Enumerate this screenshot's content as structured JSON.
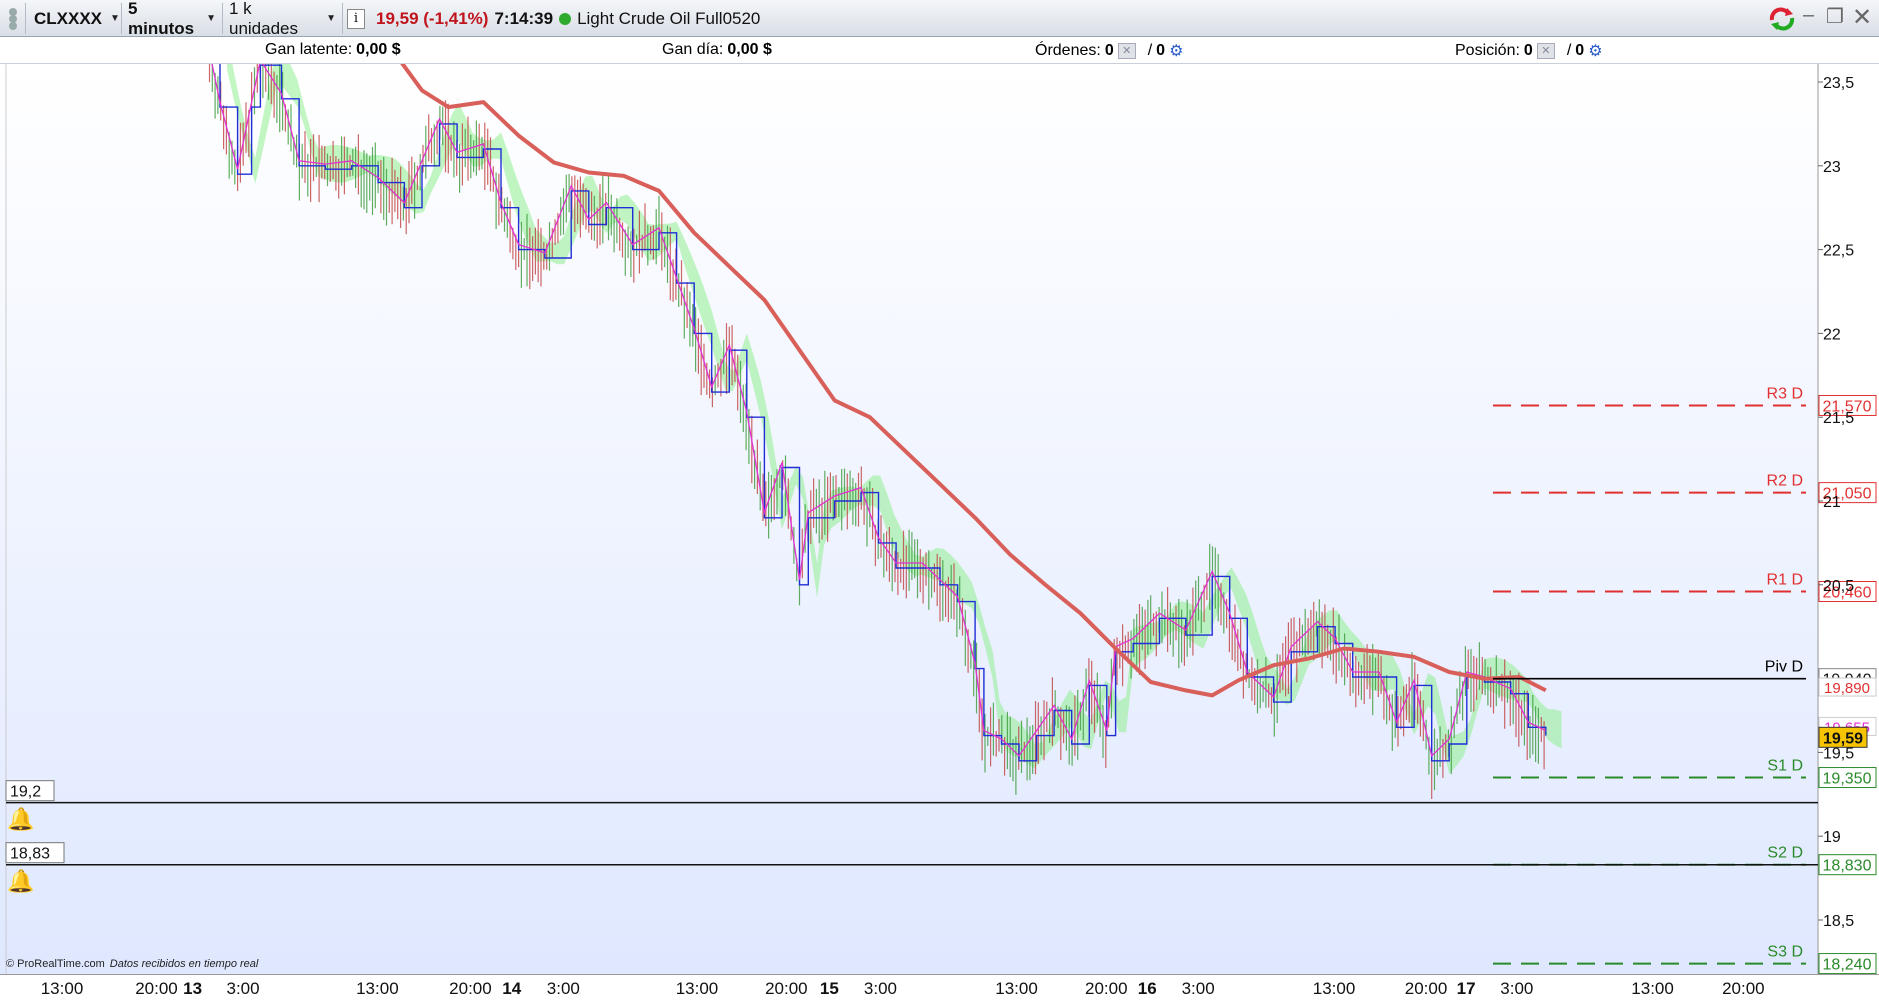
{
  "toolbar": {
    "symbol": "CLXXXX",
    "timeframe": "5 minutos",
    "units": "1 k unidades",
    "info_icon": "info-icon",
    "price_change": "19,59 (-1,41%)",
    "time": "7:14:39",
    "status_color": "#2eaa2e",
    "instrument_name": "Light Crude Oil Full0520"
  },
  "status": {
    "unrealized_label": "Gan latente:",
    "unrealized_value": "0,00 $",
    "day_label": "Gan día:",
    "day_value": "0,00 $",
    "orders_label": "Órdenes:",
    "orders_value": "0",
    "orders_value2": "0",
    "position_label": "Posición:",
    "position_value": "0",
    "position_value2": "0"
  },
  "alerts": [
    {
      "label": "19,2",
      "value": 19.2
    },
    {
      "label": "18,83",
      "value": 18.83
    }
  ],
  "footer": {
    "copyright": "© ProRealTime.com",
    "source_note": "Datos recibidos en tiempo real"
  },
  "colors": {
    "bg_top": "#ffffff",
    "bg_bottom": "#dfe8ff",
    "resistance": "#e03030",
    "support": "#2a8a2a",
    "pivot": "#000000",
    "ma_long": "#d9605a",
    "price_blue": "#1f2fd6",
    "price_magenta": "#e030d0",
    "cloud": "#90ee90",
    "last_price_bg": "#f6c400"
  },
  "chart_data": {
    "type": "line",
    "title": "",
    "ylim": [
      18.0,
      23.65
    ],
    "y_ticks": [
      {
        "v": 23.5,
        "label": "23,5"
      },
      {
        "v": 23,
        "label": "23"
      },
      {
        "v": 22.5,
        "label": "22,5"
      },
      {
        "v": 22,
        "label": "22"
      },
      {
        "v": 21.5,
        "label": "21,5"
      },
      {
        "v": 21,
        "label": "21"
      },
      {
        "v": 20.5,
        "label": "20,5"
      },
      {
        "v": 19.5,
        "label": "19,5"
      },
      {
        "v": 19,
        "label": "19"
      },
      {
        "v": 18.5,
        "label": "18,5"
      }
    ],
    "x_ticks": [
      {
        "t": 0.0,
        "label": "13:00",
        "day": false
      },
      {
        "t": 0.0538,
        "label": "20:00",
        "day": false
      },
      {
        "t": 0.0744,
        "label": "13",
        "day": true
      },
      {
        "t": 0.1031,
        "label": "3:00",
        "day": false
      },
      {
        "t": 0.1796,
        "label": "13:00",
        "day": false
      },
      {
        "t": 0.2326,
        "label": "20:00",
        "day": false
      },
      {
        "t": 0.2561,
        "label": "14",
        "day": true
      },
      {
        "t": 0.2855,
        "label": "3:00",
        "day": false
      },
      {
        "t": 0.3616,
        "label": "13:00",
        "day": false
      },
      {
        "t": 0.4125,
        "label": "20:00",
        "day": false
      },
      {
        "t": 0.437,
        "label": "15",
        "day": true
      },
      {
        "t": 0.4661,
        "label": "3:00",
        "day": false
      },
      {
        "t": 0.5436,
        "label": "13:00",
        "day": false
      },
      {
        "t": 0.5947,
        "label": "20:00",
        "day": false
      },
      {
        "t": 0.618,
        "label": "16",
        "day": true
      },
      {
        "t": 0.647,
        "label": "3:00",
        "day": false
      },
      {
        "t": 0.7244,
        "label": "13:00",
        "day": false
      },
      {
        "t": 0.7768,
        "label": "20:00",
        "day": false
      },
      {
        "t": 0.7996,
        "label": "17",
        "day": true
      },
      {
        "t": 0.8285,
        "label": "3:00",
        "day": false
      },
      {
        "t": 0.9058,
        "label": "13:00",
        "day": false
      },
      {
        "t": 0.9575,
        "label": "20:00",
        "day": false
      }
    ],
    "levels": [
      {
        "name": "R3 D",
        "value_label": "21,570",
        "value": 21.57,
        "kind": "resistance"
      },
      {
        "name": "R2 D",
        "value_label": "21,050",
        "value": 21.05,
        "kind": "resistance"
      },
      {
        "name": "R1 D",
        "value_label": "20,460",
        "value": 20.46,
        "kind": "resistance"
      },
      {
        "name": "Piv D",
        "value_label": "19,940",
        "value": 19.94,
        "kind": "pivot"
      },
      {
        "name": "S1 D",
        "value_label": "19,350",
        "value": 19.35,
        "kind": "support"
      },
      {
        "name": "S2 D",
        "value_label": "18,830",
        "value": 18.83,
        "kind": "support"
      },
      {
        "name": "S3 D",
        "value_label": "18,240",
        "value": 18.24,
        "kind": "support"
      }
    ],
    "last_price_label": "19,59",
    "last_price": 19.59,
    "marker_labels": [
      {
        "label": "19,890",
        "value": 19.89,
        "color": "#e03030"
      },
      {
        "label": "19,655",
        "value": 19.655,
        "color": "#e030d0"
      }
    ],
    "series": [
      {
        "kind": "ma",
        "points": [
          [
            0.191,
            23.65
          ],
          [
            0.205,
            23.45
          ],
          [
            0.22,
            23.35
          ],
          [
            0.24,
            23.38
          ],
          [
            0.26,
            23.18
          ],
          [
            0.28,
            23.02
          ],
          [
            0.3,
            22.96
          ],
          [
            0.32,
            22.94
          ],
          [
            0.34,
            22.85
          ],
          [
            0.36,
            22.6
          ],
          [
            0.38,
            22.4
          ],
          [
            0.4,
            22.2
          ],
          [
            0.42,
            21.9
          ],
          [
            0.44,
            21.6
          ],
          [
            0.46,
            21.5
          ],
          [
            0.48,
            21.3
          ],
          [
            0.5,
            21.1
          ],
          [
            0.52,
            20.9
          ],
          [
            0.54,
            20.68
          ],
          [
            0.56,
            20.5
          ],
          [
            0.58,
            20.33
          ],
          [
            0.6,
            20.12
          ],
          [
            0.62,
            19.92
          ],
          [
            0.64,
            19.87
          ],
          [
            0.655,
            19.84
          ],
          [
            0.67,
            19.93
          ],
          [
            0.69,
            20.02
          ],
          [
            0.71,
            20.06
          ],
          [
            0.73,
            20.12
          ],
          [
            0.75,
            20.1
          ],
          [
            0.77,
            20.07
          ],
          [
            0.79,
            19.98
          ],
          [
            0.81,
            19.94
          ],
          [
            0.83,
            19.95
          ],
          [
            0.845,
            19.87
          ]
        ]
      },
      {
        "kind": "price",
        "points": [
          [
            0.084,
            23.65
          ],
          [
            0.09,
            23.35
          ],
          [
            0.1,
            22.95
          ],
          [
            0.108,
            23.35
          ],
          [
            0.113,
            23.6
          ],
          [
            0.125,
            23.4
          ],
          [
            0.135,
            23.0
          ],
          [
            0.15,
            22.98
          ],
          [
            0.165,
            23.0
          ],
          [
            0.18,
            22.9
          ],
          [
            0.195,
            22.75
          ],
          [
            0.205,
            23.0
          ],
          [
            0.215,
            23.25
          ],
          [
            0.225,
            23.05
          ],
          [
            0.24,
            23.1
          ],
          [
            0.25,
            22.75
          ],
          [
            0.26,
            22.5
          ],
          [
            0.275,
            22.45
          ],
          [
            0.29,
            22.85
          ],
          [
            0.3,
            22.65
          ],
          [
            0.31,
            22.75
          ],
          [
            0.325,
            22.5
          ],
          [
            0.34,
            22.6
          ],
          [
            0.35,
            22.3
          ],
          [
            0.36,
            22.0
          ],
          [
            0.37,
            21.65
          ],
          [
            0.38,
            21.9
          ],
          [
            0.39,
            21.5
          ],
          [
            0.4,
            20.9
          ],
          [
            0.41,
            21.2
          ],
          [
            0.42,
            20.5
          ],
          [
            0.425,
            20.9
          ],
          [
            0.44,
            21.0
          ],
          [
            0.455,
            21.05
          ],
          [
            0.465,
            20.75
          ],
          [
            0.475,
            20.6
          ],
          [
            0.49,
            20.6
          ],
          [
            0.5,
            20.5
          ],
          [
            0.51,
            20.4
          ],
          [
            0.52,
            20.0
          ],
          [
            0.525,
            19.6
          ],
          [
            0.535,
            19.55
          ],
          [
            0.545,
            19.45
          ],
          [
            0.555,
            19.6
          ],
          [
            0.565,
            19.75
          ],
          [
            0.575,
            19.55
          ],
          [
            0.585,
            19.9
          ],
          [
            0.595,
            19.6
          ],
          [
            0.6,
            20.1
          ],
          [
            0.61,
            20.15
          ],
          [
            0.625,
            20.3
          ],
          [
            0.64,
            20.2
          ],
          [
            0.655,
            20.55
          ],
          [
            0.665,
            20.3
          ],
          [
            0.675,
            19.95
          ],
          [
            0.69,
            19.8
          ],
          [
            0.7,
            20.1
          ],
          [
            0.715,
            20.25
          ],
          [
            0.725,
            20.15
          ],
          [
            0.735,
            19.95
          ],
          [
            0.75,
            19.95
          ],
          [
            0.76,
            19.65
          ],
          [
            0.77,
            19.9
          ],
          [
            0.78,
            19.45
          ],
          [
            0.79,
            19.55
          ],
          [
            0.8,
            19.95
          ],
          [
            0.81,
            19.92
          ],
          [
            0.825,
            19.85
          ],
          [
            0.835,
            19.65
          ],
          [
            0.845,
            19.6
          ]
        ]
      }
    ],
    "grid": false,
    "legend": "none"
  }
}
